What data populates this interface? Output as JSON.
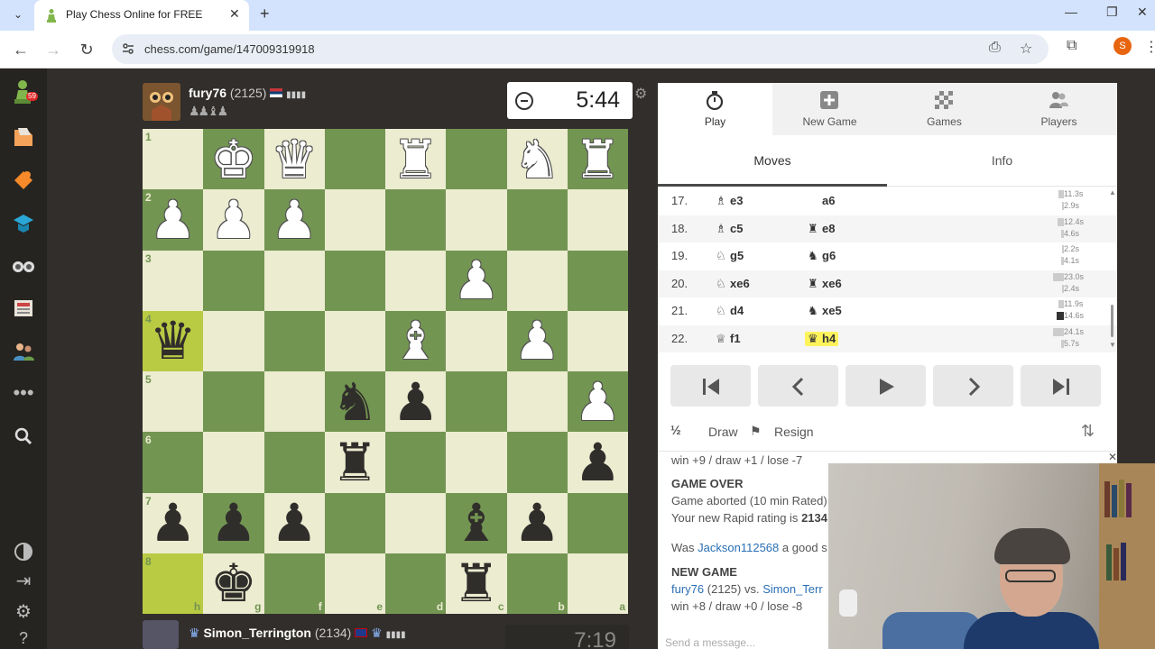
{
  "browser": {
    "tab_title": "Play Chess Online for FREE",
    "url": "chess.com/game/147009319918",
    "profile_initial": "S",
    "accent": "#d3e3fd"
  },
  "leftnav": {
    "badge": "59",
    "icons": [
      "play-pawn-icon",
      "puzzles-icon",
      "learn-icon",
      "lessons-icon",
      "watch-icon",
      "news-icon",
      "social-icon",
      "more-icon",
      "search-icon",
      "theme-icon",
      "collapse-icon",
      "settings-icon",
      "help-icon"
    ]
  },
  "top_player": {
    "name": "fury76",
    "rating": "(2125)",
    "captured": "♟♟♝♟",
    "clock": "5:44"
  },
  "bottom_player": {
    "name": "Simon_Terrington",
    "rating": "(2134)",
    "clock": "7:19"
  },
  "board": {
    "orientation": "black",
    "ranks": [
      "1",
      "2",
      "3",
      "4",
      "5",
      "6",
      "7",
      "8"
    ],
    "files": [
      "h",
      "g",
      "f",
      "e",
      "d",
      "c",
      "b",
      "a"
    ],
    "light_color": "#ebecd0",
    "dark_color": "#739552",
    "highlight_color": "#b9ca43",
    "position": [
      [
        "",
        "wK",
        "wQ",
        "",
        "wR",
        "",
        "wN",
        "wR"
      ],
      [
        "wP",
        "wP",
        "wP",
        "",
        "",
        "",
        "",
        ""
      ],
      [
        "",
        "",
        "",
        "",
        "",
        "wP",
        "",
        ""
      ],
      [
        "bQ",
        "",
        "",
        "",
        "wB",
        "",
        "wP",
        ""
      ],
      [
        "",
        "",
        "",
        "bN",
        "bP",
        "",
        "",
        "wP"
      ],
      [
        "",
        "",
        "",
        "bR",
        "",
        "",
        "",
        "bP"
      ],
      [
        "bP",
        "bP",
        "bP",
        "",
        "",
        "bB",
        "bP",
        ""
      ],
      [
        "",
        "bK",
        "",
        "",
        "",
        "bR",
        "",
        ""
      ]
    ],
    "highlights": [
      "h4",
      "h8"
    ]
  },
  "panel": {
    "tabs": [
      {
        "label": "Play",
        "icon": "stopwatch-icon"
      },
      {
        "label": "New Game",
        "icon": "plus-box-icon"
      },
      {
        "label": "Games",
        "icon": "chessboard-icon"
      },
      {
        "label": "Players",
        "icon": "players-icon"
      }
    ],
    "subtabs": [
      "Moves",
      "Info"
    ],
    "moves": [
      {
        "num": "17.",
        "w_fig": "♗",
        "white": "e3",
        "b_fig": "",
        "black": "a6",
        "tw": "11.3s",
        "tb": "2.9s",
        "bw": 6,
        "bb": 2
      },
      {
        "num": "18.",
        "w_fig": "♗",
        "white": "c5",
        "b_fig": "♜",
        "black": "e8",
        "tw": "12.4s",
        "tb": "4.6s",
        "bw": 7,
        "bb": 3
      },
      {
        "num": "19.",
        "w_fig": "♘",
        "white": "g5",
        "b_fig": "♞",
        "black": "g6",
        "tw": "2.2s",
        "tb": "4.1s",
        "bw": 2,
        "bb": 3
      },
      {
        "num": "20.",
        "w_fig": "♘",
        "white": "xe6",
        "b_fig": "♜",
        "black": "xe6",
        "tw": "23.0s",
        "tb": "2.4s",
        "bw": 12,
        "bb": 2
      },
      {
        "num": "21.",
        "w_fig": "♘",
        "white": "d4",
        "b_fig": "♞",
        "black": "xe5",
        "tw": "11.9s",
        "tb": "14.6s",
        "bw": 6,
        "bb": 8
      },
      {
        "num": "22.",
        "w_fig": "♕",
        "white": "f1",
        "b_fig": "♛",
        "black": "h4",
        "tw": "24.1s",
        "tb": "5.7s",
        "bw": 12,
        "bb": 3
      }
    ],
    "draw_icon": "½",
    "draw": "Draw",
    "resign": "Resign"
  },
  "chat": {
    "line1": "win +9 / draw +1 / lose -7",
    "game_over": "GAME OVER",
    "aborted": "Game aborted (10 min Rated)",
    "new_rating_prefix": "Your new Rapid rating is",
    "new_rating": "2134",
    "was_prefix": "Was",
    "was_user": "Jackson112568",
    "was_suffix": "a good s",
    "new_game": "NEW GAME",
    "ng_white": "fury76",
    "ng_white_rating": "(2125) vs.",
    "ng_black": "Simon_Terr",
    "line_last": "win +8 / draw +0 / lose -8",
    "placeholder": "Send a message..."
  }
}
